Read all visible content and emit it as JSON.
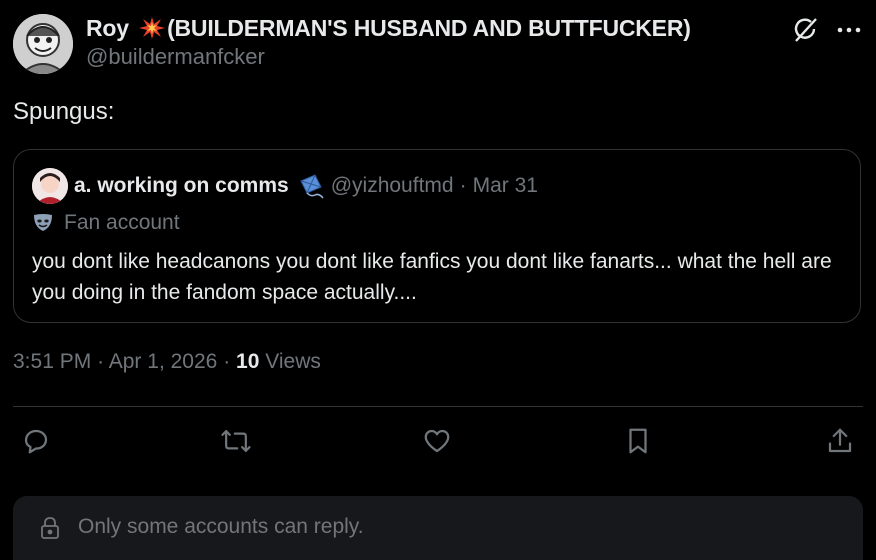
{
  "author": {
    "display_name": "Roy",
    "display_name_rest": "(BUILDERMAN'S HUSBAND AND BUTTFUCKER)",
    "handle": "@buildermanfcker",
    "badge_icon": "collision-emoji-icon"
  },
  "top_icons": [
    "grok-icon",
    "more-icon"
  ],
  "tweet": {
    "text": "Spungus:"
  },
  "quoted_tweet": {
    "display_name": "a. working on comms",
    "handle": "@yizhouftmd",
    "separator": "·",
    "date": "Mar 31",
    "label": "Fan account",
    "text": "you dont like headcanons you dont like fanfics you dont like fanarts... what the hell are you doing in the fandom space actually...."
  },
  "meta": {
    "time": "3:51 PM",
    "separator": "·",
    "date": "Apr 1, 2026",
    "views_count": "10",
    "views_label": "Views"
  },
  "actions": [
    "reply-icon",
    "retweet-icon",
    "like-icon",
    "bookmark-icon",
    "share-icon"
  ],
  "reply_restriction": {
    "text": "Only some accounts can reply."
  },
  "colors": {
    "background": "#000000",
    "text": "#e7e9ea",
    "muted": "#71767b",
    "border": "#2f3336",
    "reply_box": "#16181c"
  }
}
